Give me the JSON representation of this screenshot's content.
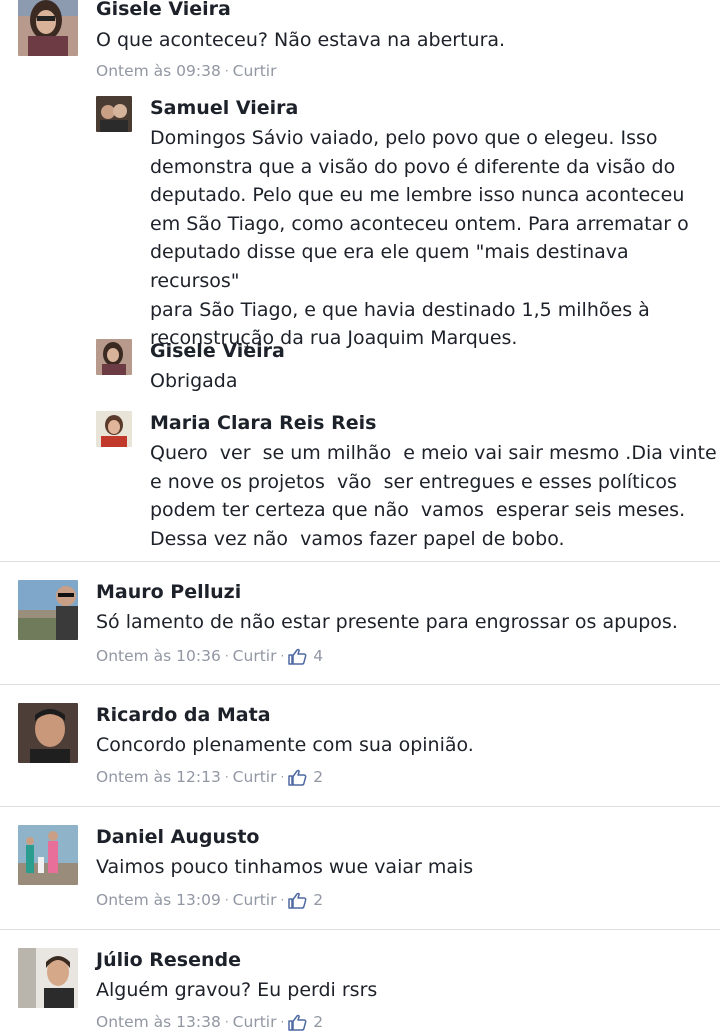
{
  "comments": [
    {
      "author": "Gisele Vieira",
      "text": "O que aconteceu? Não estava na abertura.",
      "time": "Ontem às 09:38",
      "like_label": "Curtir",
      "replies": [
        {
          "author": "Samuel Vieira",
          "text": "Domingos Sávio vaiado, pelo povo que o elegeu. Isso\ndemonstra que a visão do povo é diferente da visão do\ndeputado. Pelo que eu me lembre isso nunca aconteceu\nem São Tiago, como aconteceu ontem. Para arrematar o\ndeputado disse que era ele quem \"mais destinava recursos\"\npara São Tiago, e que havia destinado 1,5 milhões à\nreconstrução da rua Joaquim Marques."
        },
        {
          "author": "Gisele Vieira",
          "text": "Obrigada"
        },
        {
          "author": "Maria Clara Reis Reis",
          "text": "Quero  ver  se um milhão  e meio vai sair mesmo .Dia vinte\ne nove os projetos  vão  ser entregues e esses políticos\npodem ter certeza que não  vamos  esperar seis meses.\nDessa vez não  vamos fazer papel de bobo."
        }
      ]
    },
    {
      "author": "Mauro Pelluzi",
      "text": "Só lamento de não estar presente para engrossar os apupos.",
      "time": "Ontem às 10:36",
      "like_label": "Curtir",
      "likes": "4"
    },
    {
      "author": "Ricardo da Mata",
      "text": "Concordo plenamente com sua opinião.",
      "time": "Ontem às 12:13",
      "like_label": "Curtir",
      "likes": "2"
    },
    {
      "author": "Daniel Augusto",
      "text": "Vaimos pouco tinhamos wue vaiar mais",
      "time": "Ontem às 13:09",
      "like_label": "Curtir",
      "likes": "2"
    },
    {
      "author": "Júlio Resende",
      "text": "Alguém gravou? Eu perdi rsrs",
      "time": "Ontem às 13:38",
      "like_label": "Curtir",
      "likes": "2"
    }
  ],
  "icons": {
    "like": "thumbs-up-icon",
    "separator": "·"
  },
  "colors": {
    "name": "#1d2129",
    "meta": "#9197a3",
    "like_icon": "#4e69a2",
    "divider": "#dddfe2"
  }
}
